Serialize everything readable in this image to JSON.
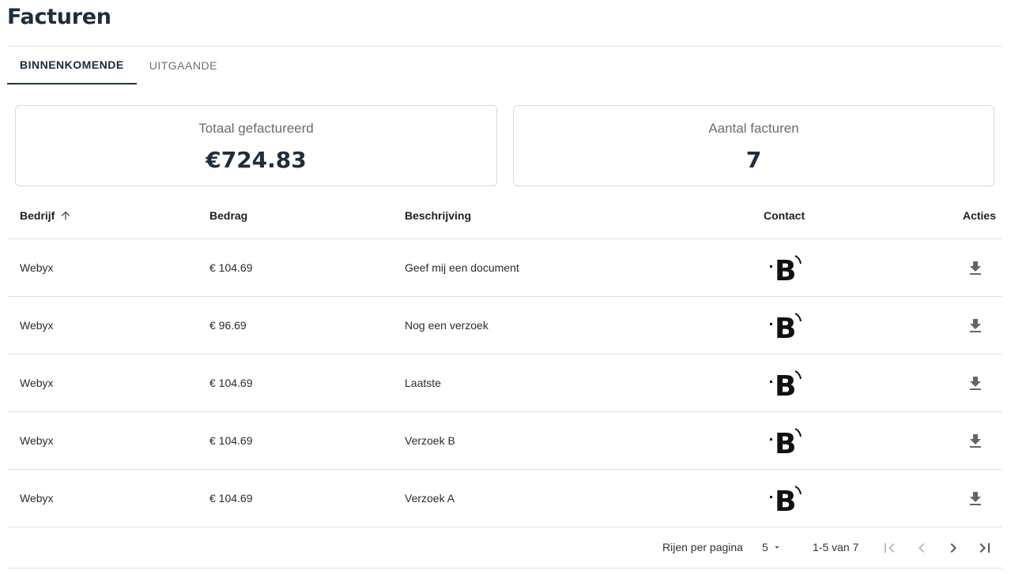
{
  "page": {
    "title": "Facturen"
  },
  "tabs": [
    {
      "label": "BINNENKOMENDE",
      "active": true
    },
    {
      "label": "UITGAANDE",
      "active": false
    }
  ],
  "summary": {
    "total_label": "Totaal gefactureerd",
    "total_value": "€724.83",
    "count_label": "Aantal facturen",
    "count_value": "7"
  },
  "table": {
    "columns": {
      "bedrijf": "Bedrijf",
      "bedrag": "Bedrag",
      "beschrijving": "Beschrijving",
      "contact": "Contact",
      "acties": "Acties"
    },
    "sort_icon": "arrow-up-icon",
    "contact_icon": "company-logo-icon",
    "action_icon": "download-icon",
    "rows": [
      {
        "bedrijf": "Webyx",
        "bedrag": "€ 104.69",
        "beschrijving": "Geef mij een document"
      },
      {
        "bedrijf": "Webyx",
        "bedrag": "€ 96.69",
        "beschrijving": "Nog een verzoek"
      },
      {
        "bedrijf": "Webyx",
        "bedrag": "€ 104.69",
        "beschrijving": "Laatste"
      },
      {
        "bedrijf": "Webyx",
        "bedrag": "€ 104.69",
        "beschrijving": "Verzoek B"
      },
      {
        "bedrijf": "Webyx",
        "bedrag": "€ 104.69",
        "beschrijving": "Verzoek A"
      }
    ]
  },
  "pagination": {
    "rows_per_page_label": "Rijen per pagina",
    "rows_per_page_value": "5",
    "range_label": "1-5 van 7",
    "first_page_enabled": false,
    "prev_page_enabled": false,
    "next_page_enabled": true,
    "last_page_enabled": true
  },
  "colors": {
    "title": "#1f2d3d",
    "active_tab_indicator": "#1f3a3f",
    "disabled_icon": "#bdbdbd",
    "enabled_icon": "#555555"
  }
}
